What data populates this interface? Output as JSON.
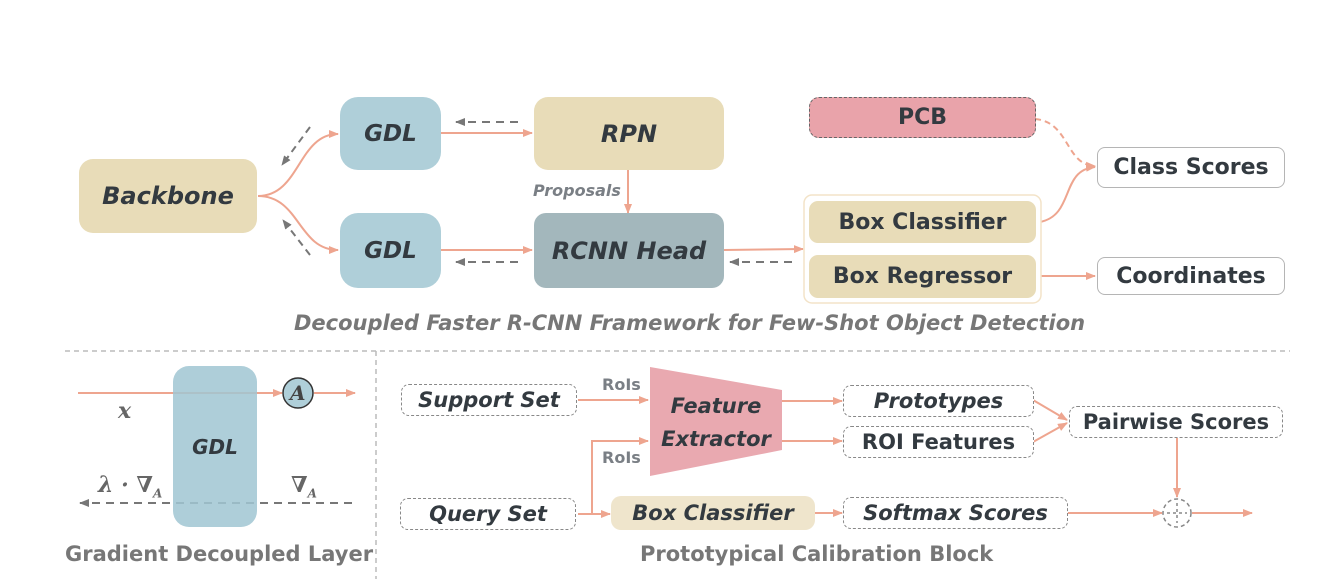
{
  "top": {
    "backbone": "Backbone",
    "gdl_top": "GDL",
    "gdl_bottom": "GDL",
    "rpn": "RPN",
    "rcnn_head": "RCNN Head",
    "proposals_label": "Proposals",
    "pcb": "PCB",
    "box_classifier": "Box Classifier",
    "box_regressor": "Box Regressor",
    "class_scores": "Class Scores",
    "coordinates": "Coordinates",
    "caption": "Decoupled Faster R-CNN Framework for Few-Shot Object Detection"
  },
  "gdl_panel": {
    "block": "GDL",
    "x_label": "x",
    "lambda_label": "λ · ∇",
    "lambda_sub": "A",
    "grad_label": "∇",
    "grad_sub": "A",
    "op_symbol": "A",
    "caption": "Gradient Decoupled Layer"
  },
  "pcb_panel": {
    "support_set": "Support Set",
    "query_set": "Query Set",
    "rois_top": "RoIs",
    "rois_bottom": "RoIs",
    "feature_extractor_line1": "Feature",
    "feature_extractor_line2": "Extractor",
    "box_classifier": "Box Classifier",
    "prototypes": "Prototypes",
    "roi_features": "ROI Features",
    "pairwise_scores": "Pairwise Scores",
    "softmax_scores": "Softmax Scores",
    "caption": "Prototypical Calibration Block"
  },
  "colors": {
    "forward_arrow": "#eea58f",
    "backward_arrow": "#777777",
    "tan": "#e8dcb8",
    "blue": "#afcfd9",
    "slate": "#a3b7bc",
    "pink": "#e9a3aa"
  }
}
